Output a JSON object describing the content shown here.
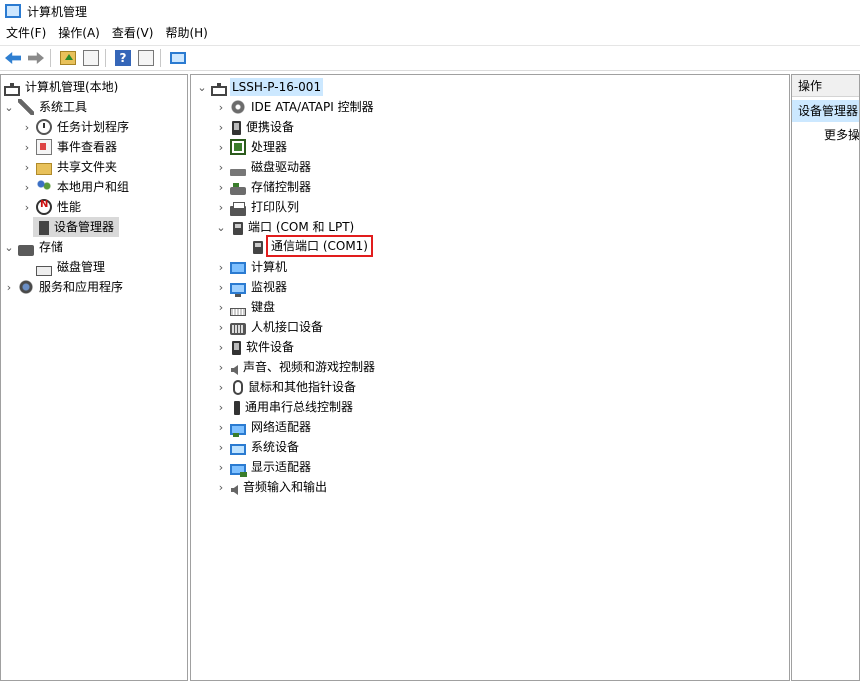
{
  "window": {
    "title": "计算机管理"
  },
  "menubar": {
    "items": [
      "文件(F)",
      "操作(A)",
      "查看(V)",
      "帮助(H)"
    ]
  },
  "toolbar": {
    "icons": [
      "back-arrow-icon",
      "forward-arrow-icon",
      "up-folder-icon",
      "show-hide-tree-icon",
      "help-icon",
      "properties-icon",
      "computer-icon"
    ]
  },
  "left_tree": {
    "root": "计算机管理(本地)",
    "system_tools": "系统工具",
    "task_scheduler": "任务计划程序",
    "event_viewer": "事件查看器",
    "shared_folders": "共享文件夹",
    "local_users": "本地用户和组",
    "performance": "性能",
    "device_manager": "设备管理器",
    "storage": "存储",
    "disk_management": "磁盘管理",
    "services_apps": "服务和应用程序"
  },
  "device_tree": {
    "computer_name": "LSSH-P-16-001",
    "categories": [
      "IDE ATA/ATAPI 控制器",
      "便携设备",
      "处理器",
      "磁盘驱动器",
      "存储控制器",
      "打印队列",
      "端口 (COM 和 LPT)",
      "计算机",
      "监视器",
      "键盘",
      "人机接口设备",
      "软件设备",
      "声音、视频和游戏控制器",
      "鼠标和其他指针设备",
      "通用串行总线控制器",
      "网络适配器",
      "系统设备",
      "显示适配器",
      "音频输入和输出"
    ],
    "port_child": "通信端口 (COM1)"
  },
  "actions_pane": {
    "header": "操作",
    "selected": "设备管理器",
    "more": "更多操"
  },
  "colors": {
    "selection_blue": "#cce8ff",
    "selection_gray": "#d9d9d9",
    "highlight_red": "#e11d1d"
  }
}
